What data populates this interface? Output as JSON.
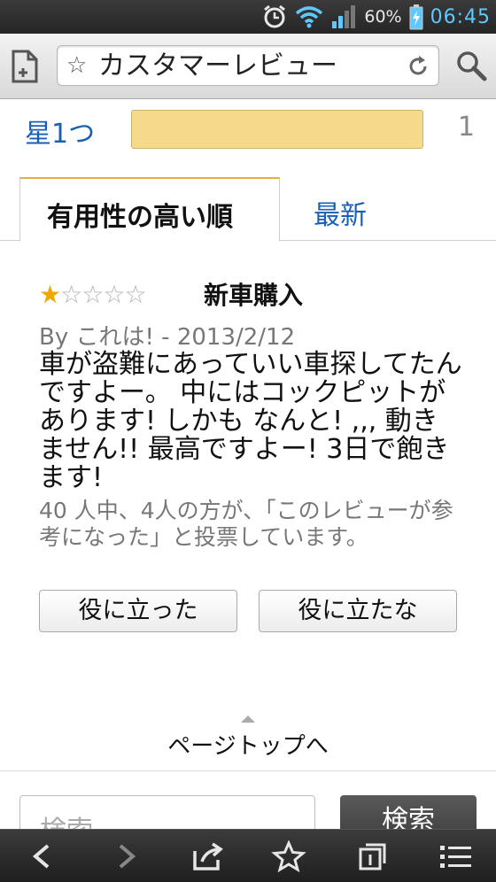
{
  "status_bar": {
    "battery_percent": "60%",
    "time": "06:45",
    "icons": [
      "alarm-icon",
      "wifi-icon",
      "signal-icon",
      "battery-charging-icon"
    ]
  },
  "browser": {
    "page_title": "カスタマーレビュー",
    "icons": [
      "new-tab-icon",
      "bookmark-star-icon",
      "reload-icon",
      "search-icon"
    ]
  },
  "rating_summary": {
    "label": "星1つ",
    "count": "1",
    "fill_fraction": 1.0
  },
  "tabs": [
    {
      "label": "有用性の高い順",
      "active": true
    },
    {
      "label": "最新",
      "active": false
    }
  ],
  "review": {
    "rating": 1,
    "max_rating": 5,
    "title": "新車購入",
    "meta": "By これは! - 2013/2/12",
    "body": "車が盗難にあっていい車探してたんですよー。 中にはコックピットがあります! しかも なんと! ,,, 動きません!! 最高ですよー! 3日で飽きます!",
    "helpful_text": "40 人中、4人の方が、「このレビューが参考になった」と投票しています。",
    "vote_helpful_label": "役に立った",
    "vote_not_helpful_label": "役に立たな"
  },
  "page_top_label": "ページトップへ",
  "search": {
    "placeholder": "検索",
    "button_label": "検索"
  },
  "bottom_bar": {
    "icons": [
      "back-icon",
      "forward-icon",
      "share-icon",
      "bookmark-icon",
      "tabs-icon",
      "menu-icon"
    ]
  }
}
